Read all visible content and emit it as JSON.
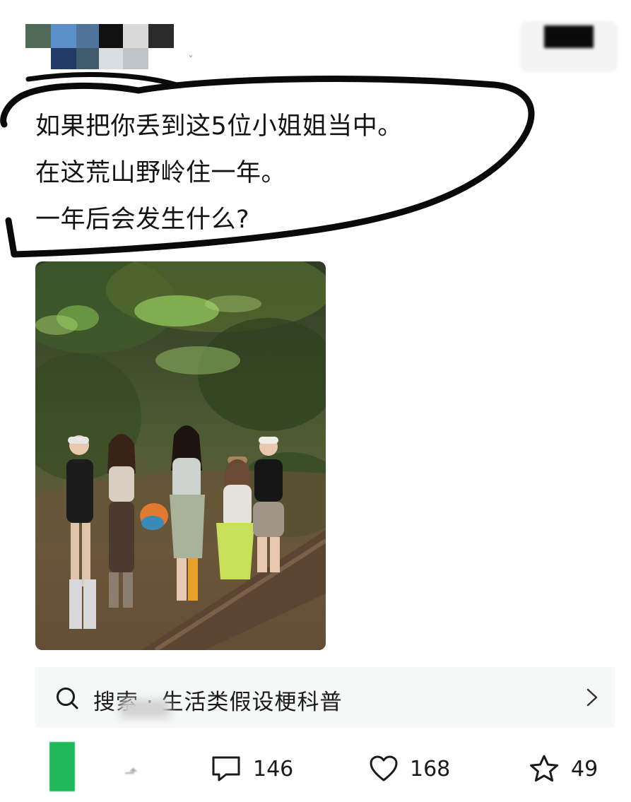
{
  "post": {
    "lines": [
      "如果把你丢到这5位小姐姐当中。",
      "在这荒山野岭住一年。",
      "一年后会发生什么?"
    ]
  },
  "search": {
    "label": "搜索 · 生活类假设梗科普"
  },
  "actions": {
    "comments": "146",
    "likes": "168",
    "favorites": "49"
  },
  "icons": {
    "search": "search-icon",
    "chevron": "chevron-right-icon",
    "comment": "comment-icon",
    "like": "heart-icon",
    "favorite": "star-icon"
  },
  "colors": {
    "accent_green": "#1fb85a",
    "search_bg": "#f6f8f7",
    "text": "#141414"
  }
}
